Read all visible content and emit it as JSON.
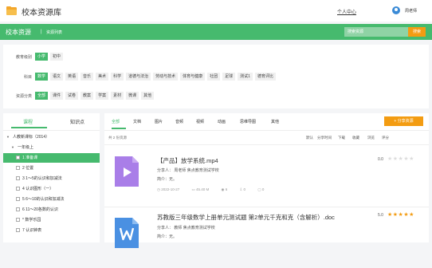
{
  "header": {
    "app_title": "校本资源库",
    "personal_center": "个人中心",
    "user_name": "周老师"
  },
  "greenbar": {
    "title": "校本资源",
    "separator": "|",
    "subtitle": "资源列表",
    "search_placeholder": "搜索资源",
    "search_button": "搜索"
  },
  "filters": {
    "level": {
      "label": "教育级别",
      "options": [
        "小学",
        "初中"
      ],
      "active": 0
    },
    "subject": {
      "label": "科目",
      "options": [
        "数学",
        "语文",
        "英语",
        "音乐",
        "美术",
        "科学",
        "道德与法治",
        "劳动与技术",
        "体育与健康",
        "社团",
        "足球",
        "测试1",
        "德育评比"
      ],
      "active": 0
    },
    "category": {
      "label": "资源分类",
      "options": [
        "全部",
        "课件",
        "试卷",
        "教案",
        "学案",
        "素材",
        "微课",
        "其他"
      ],
      "active": 0
    }
  },
  "sidebar": {
    "tabs": [
      "课程",
      "知识点"
    ],
    "tree": [
      {
        "label": "人教新课标（2014）",
        "level": 0
      },
      {
        "label": "一年级上",
        "level": 1
      },
      {
        "label": "1 准备课",
        "level": 2,
        "selected": true
      },
      {
        "label": "2 位置",
        "level": 2
      },
      {
        "label": "3 1～5的认识和加减法",
        "level": 2
      },
      {
        "label": "4 认识图形（一）",
        "level": 2
      },
      {
        "label": "5 6～10的认识和加减法",
        "level": 2
      },
      {
        "label": "6 11～20各数的认识",
        "level": 2
      },
      {
        "label": "* 数学乐园",
        "level": 2
      },
      {
        "label": "7 认识钟表",
        "level": 2
      }
    ]
  },
  "main": {
    "tabs": [
      "全部",
      "文档",
      "图片",
      "音频",
      "视频",
      "动画",
      "思维导图",
      "其他"
    ],
    "share_button": "+ 分享资源",
    "count_text": "共 2 份资源",
    "sort": [
      "默认",
      "分享时间",
      "下载",
      "收藏",
      "浏览",
      "评分"
    ],
    "resources": [
      {
        "title": "【产品】放学系统.mp4",
        "sharer": "分享人： 周老师   焦点教育测试学校",
        "summary": "简介：无。",
        "date": "2022-10-27",
        "size": "45.40 M",
        "views": "6",
        "downloads": "0",
        "comments": "0",
        "score": "0.0",
        "stars": 0,
        "type": "video",
        "thumb_color": "#a97ee8"
      },
      {
        "title": "苏教版三年级数学上册单元测试题 第2单元千克和克（含解析）.doc",
        "sharer": "分享人： 教师   焦点教育测试学校",
        "summary": "简介：无。",
        "score": "5.0",
        "stars": 5,
        "type": "doc",
        "thumb_color": "#4a90e2"
      }
    ]
  },
  "colors": {
    "brand_green": "#46ba6e",
    "accent_orange": "#f39c12",
    "star": "#f39c12"
  }
}
